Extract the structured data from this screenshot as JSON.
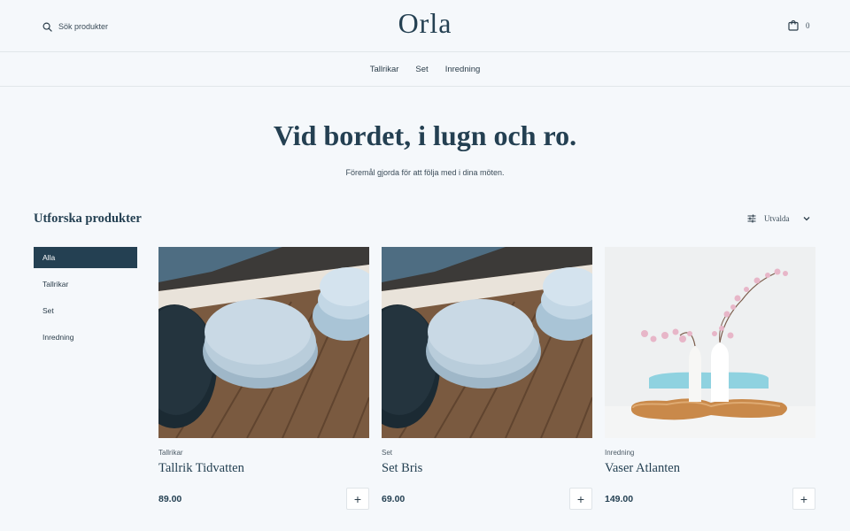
{
  "header": {
    "search_placeholder": "Sök produkter",
    "logo": "Orla",
    "cart_count": "0"
  },
  "nav": {
    "items": [
      {
        "label": "Tallrikar"
      },
      {
        "label": "Set"
      },
      {
        "label": "Inredning"
      }
    ]
  },
  "hero": {
    "title": "Vid bordet, i lugn och ro.",
    "subtitle": "Föremål gjorda för att följa med i dina möten."
  },
  "products_section": {
    "title": "Utforska produkter",
    "sort_label": "Utvalda"
  },
  "filters": [
    {
      "label": "Alla",
      "active": true
    },
    {
      "label": "Tallrikar",
      "active": false
    },
    {
      "label": "Set",
      "active": false
    },
    {
      "label": "Inredning",
      "active": false
    }
  ],
  "products": [
    {
      "category": "Tallrikar",
      "name": "Tallrik Tidvatten",
      "price": "89.00",
      "add_label": "+"
    },
    {
      "category": "Set",
      "name": "Set Bris",
      "price": "69.00",
      "add_label": "+"
    },
    {
      "category": "Inredning",
      "name": "Vaser Atlanten",
      "price": "149.00",
      "add_label": "+"
    }
  ],
  "colors": {
    "background": "#f5f8fb",
    "brand": "#244052",
    "divider": "#e1e6ea"
  },
  "icons": {
    "search": "search-icon",
    "cart": "shopping-bag-icon",
    "sort": "sliders-icon",
    "dropdown": "chevron-down-icon",
    "add": "plus-icon"
  }
}
